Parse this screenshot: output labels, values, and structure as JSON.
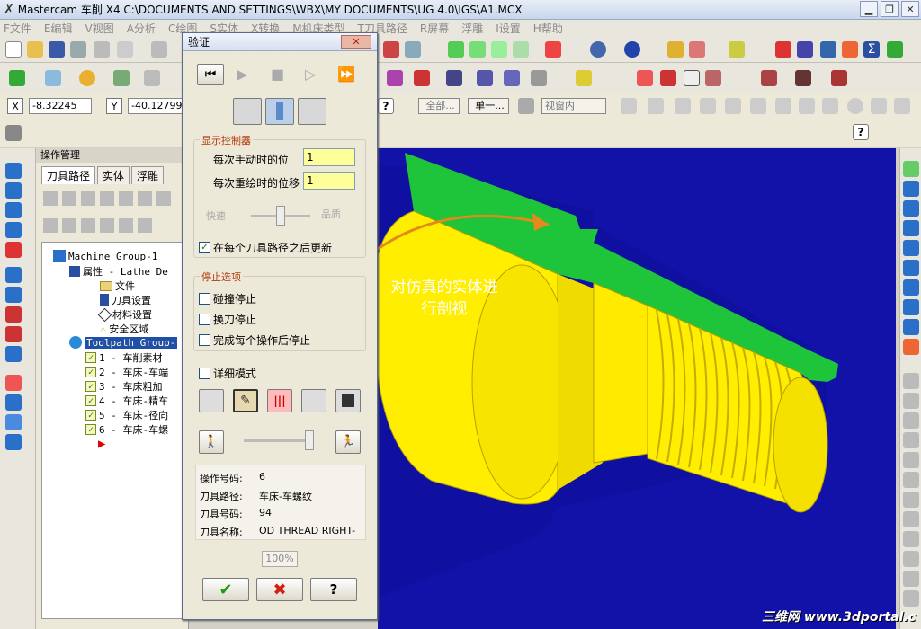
{
  "window": {
    "title": "Mastercam 车削  X4  C:\\DOCUMENTS AND SETTINGS\\WBX\\MY DOCUMENTS\\UG 4.0\\IGS\\A1.MCX"
  },
  "menu": [
    "F文件",
    "E编辑",
    "V视图",
    "A分析",
    "C绘图",
    "S实体",
    "X转换",
    "M机床类型",
    "T刀具路径",
    "R屏幕",
    "浮雕",
    "I设置",
    "H帮助"
  ],
  "coords": {
    "x_label": "X",
    "x_value": "-8.32245",
    "y_label": "Y",
    "y_value": "-40.12799"
  },
  "toolbar3": {
    "all_btn": "全部...",
    "single_btn": "单一...",
    "view_dropdown": "视窗内"
  },
  "opmgr": {
    "header": "操作管理",
    "tabs": [
      "刀具路径",
      "实体",
      "浮雕"
    ],
    "tree": [
      {
        "label": "Machine Group-1"
      },
      {
        "label": "属性 - Lathe De"
      },
      {
        "label": "文件"
      },
      {
        "label": "刀具设置"
      },
      {
        "label": "材料设置"
      },
      {
        "label": "安全区域"
      },
      {
        "label": "Toolpath Group-"
      },
      {
        "label": "1 - 车削素材"
      },
      {
        "label": "2 - 车床-车端"
      },
      {
        "label": "3 - 车床粗加"
      },
      {
        "label": "4 - 车床-精车"
      },
      {
        "label": "5 - 车床-径向"
      },
      {
        "label": "6 - 车床-车螺"
      }
    ]
  },
  "dialog": {
    "title": "验证",
    "display_group": "显示控制器",
    "step_label": "每次手动时的位",
    "step_value": "1",
    "redraw_label": "每次重绘时的位移",
    "redraw_value": "1",
    "speed_label": "快速",
    "quality_label": "品质",
    "update_label": "在每个刀具路径之后更新",
    "stop_group": "停止选项",
    "stop_collision": "碰撞停止",
    "stop_toolchange": "换刀停止",
    "stop_each_op": "完成每个操作后停止",
    "verbose": "详细模式",
    "info": {
      "op_label": "操作号码:",
      "op_value": "6",
      "path_label": "刀具路径:",
      "path_value": "车床-车螺纹",
      "tool_label": "刀具号码:",
      "tool_value": "94",
      "name_label": "刀具名称:",
      "name_value": "OD THREAD RIGHT-"
    },
    "percent": "100%"
  },
  "callout": {
    "line1": "对仿真的实体进",
    "line2": "行剖视"
  },
  "watermark": "三维网 www.3dportal.c",
  "colors": {
    "viewport_bg": "#1212a8",
    "part_yellow": "#ffee00",
    "section_green": "#1ec43a",
    "accent_orange": "#e28a1a"
  }
}
